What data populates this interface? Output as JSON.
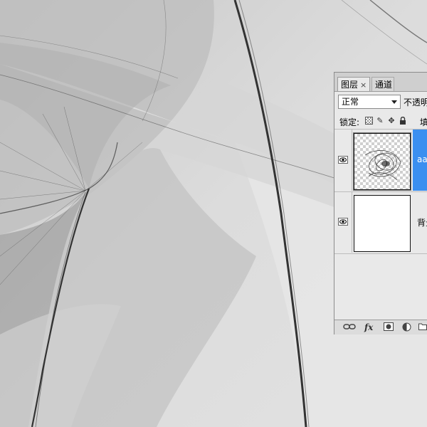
{
  "panel": {
    "tabs": [
      {
        "label": "图层",
        "close": "×"
      },
      {
        "label": "通道"
      }
    ],
    "blend_mode": "正常",
    "opacity_label": "不透明",
    "lock_label": "锁定:",
    "lock_icons": [
      "lock-transparent-icon",
      "brush-icon",
      "move-icon",
      "lock-icon"
    ],
    "fill_label": "填",
    "layers": [
      {
        "name": "aa",
        "visible": true,
        "selected": true,
        "thumb": "transparent-with-artwork"
      },
      {
        "name": "背景",
        "visible": true,
        "selected": false,
        "thumb": "white"
      }
    ],
    "bottom_icons": [
      "link-icon",
      "fx-icon",
      "mask-icon",
      "adjustment-icon",
      "folder-icon"
    ],
    "fx_label": "fx"
  },
  "colors": {
    "selection": "#3b8ff0",
    "panel_bg": "#e9e9e9"
  }
}
